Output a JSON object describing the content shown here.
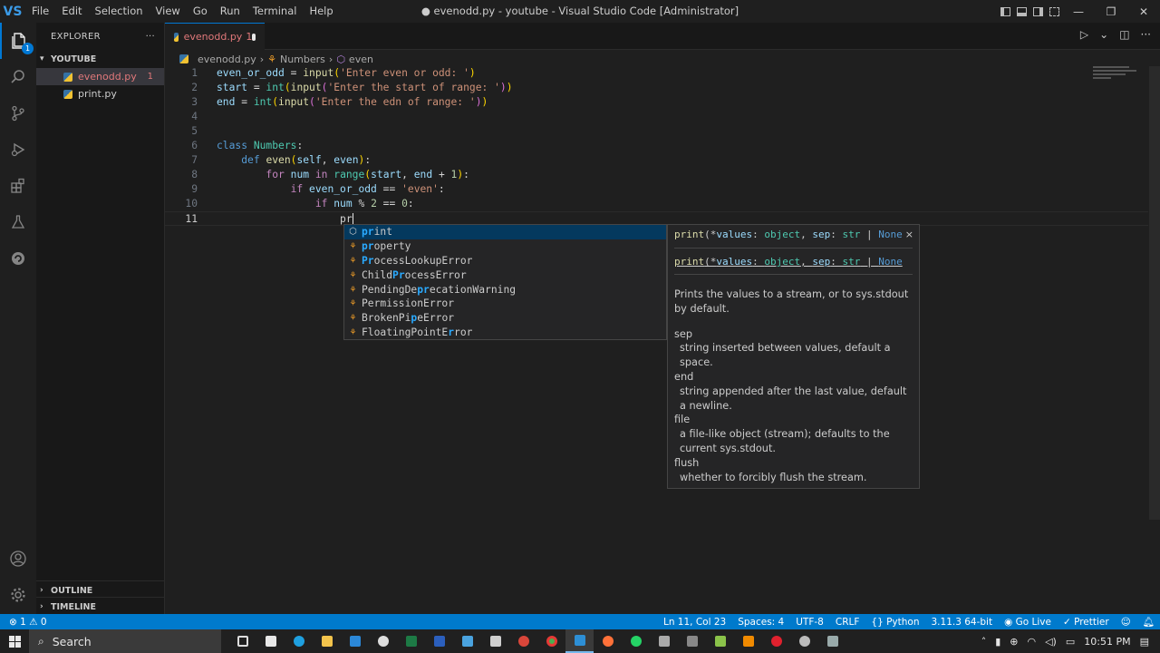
{
  "titlebar": {
    "logo": "VS",
    "menu": [
      "File",
      "Edit",
      "Selection",
      "View",
      "Go",
      "Run",
      "Terminal",
      "Help"
    ],
    "title": "● evenodd.py - youtube - Visual Studio Code [Administrator]",
    "minimize": "—",
    "restore": "❐",
    "close": "✕"
  },
  "activity": {
    "explorer_badge": "1"
  },
  "sidebar": {
    "header": "EXPLORER",
    "more": "···",
    "folder": "YOUTUBE",
    "files": [
      {
        "name": "evenodd.py",
        "count": "1"
      },
      {
        "name": "print.py"
      }
    ],
    "outline": "OUTLINE",
    "timeline": "TIMELINE"
  },
  "editor": {
    "tab": {
      "name": "evenodd.py",
      "problems": "1"
    },
    "breadcrumbs": {
      "file": "evenodd.py",
      "sep": "›",
      "cls": "Numbers",
      "method": "even"
    },
    "line_numbers": [
      "1",
      "2",
      "3",
      "4",
      "5",
      "6",
      "7",
      "8",
      "9",
      "10",
      "11"
    ],
    "current_line": "11"
  },
  "suggest": {
    "items": [
      {
        "hl": "pr",
        "rest": "int",
        "kind": "method-icon"
      },
      {
        "hl": "pr",
        "rest": "operty",
        "kind": "class-icon"
      },
      {
        "hl": "Pr",
        "rest": "ocessLookupError",
        "kind": "class-icon"
      },
      {
        "pre": "Child",
        "hl": "Pr",
        "rest": "ocessError",
        "kind": "class-icon"
      },
      {
        "pre": "PendingDe",
        "hl": "pr",
        "rest": "ecationWarning",
        "kind": "class-icon"
      },
      {
        "pre": "Permission",
        "hl": "",
        "rest": "Error",
        "kind": "class-icon"
      },
      {
        "pre": "BrokenPi",
        "hl": "p",
        "rest": "eError",
        "kind": "class-icon"
      },
      {
        "pre": "FloatingPointE",
        "hl": "r",
        "rest": "ror",
        "kind": "class-icon"
      }
    ]
  },
  "docs": {
    "signature": {
      "fn": "print",
      "open": "(*",
      "p1": "values",
      "c1": ": ",
      "t1": "object",
      "sep1": ", ",
      "p2": "sep",
      "c2": ": ",
      "t2": "str",
      "bar": " | ",
      "none": "None"
    },
    "close": "×",
    "description": "Prints the values to a stream, or to sys.stdout by default.",
    "params": [
      {
        "name": "sep",
        "desc": "string inserted between values, default a space."
      },
      {
        "name": "end",
        "desc": "string appended after the last value, default a newline."
      },
      {
        "name": "file",
        "desc": "a file-like object (stream); defaults to the current sys.stdout."
      },
      {
        "name": "flush",
        "desc": "whether to forcibly flush the stream."
      }
    ]
  },
  "status": {
    "problems": "⊗ 1 ⚠ 0",
    "position": "Ln 11, Col 23",
    "spaces": "Spaces: 4",
    "encoding": "UTF-8",
    "eol": "CRLF",
    "language": "{} Python",
    "interpreter": "3.11.3 64-bit",
    "golive": "Go Live",
    "prettier": "✓ Prettier"
  },
  "taskbar": {
    "search": "Search",
    "time": "10:51 PM"
  }
}
